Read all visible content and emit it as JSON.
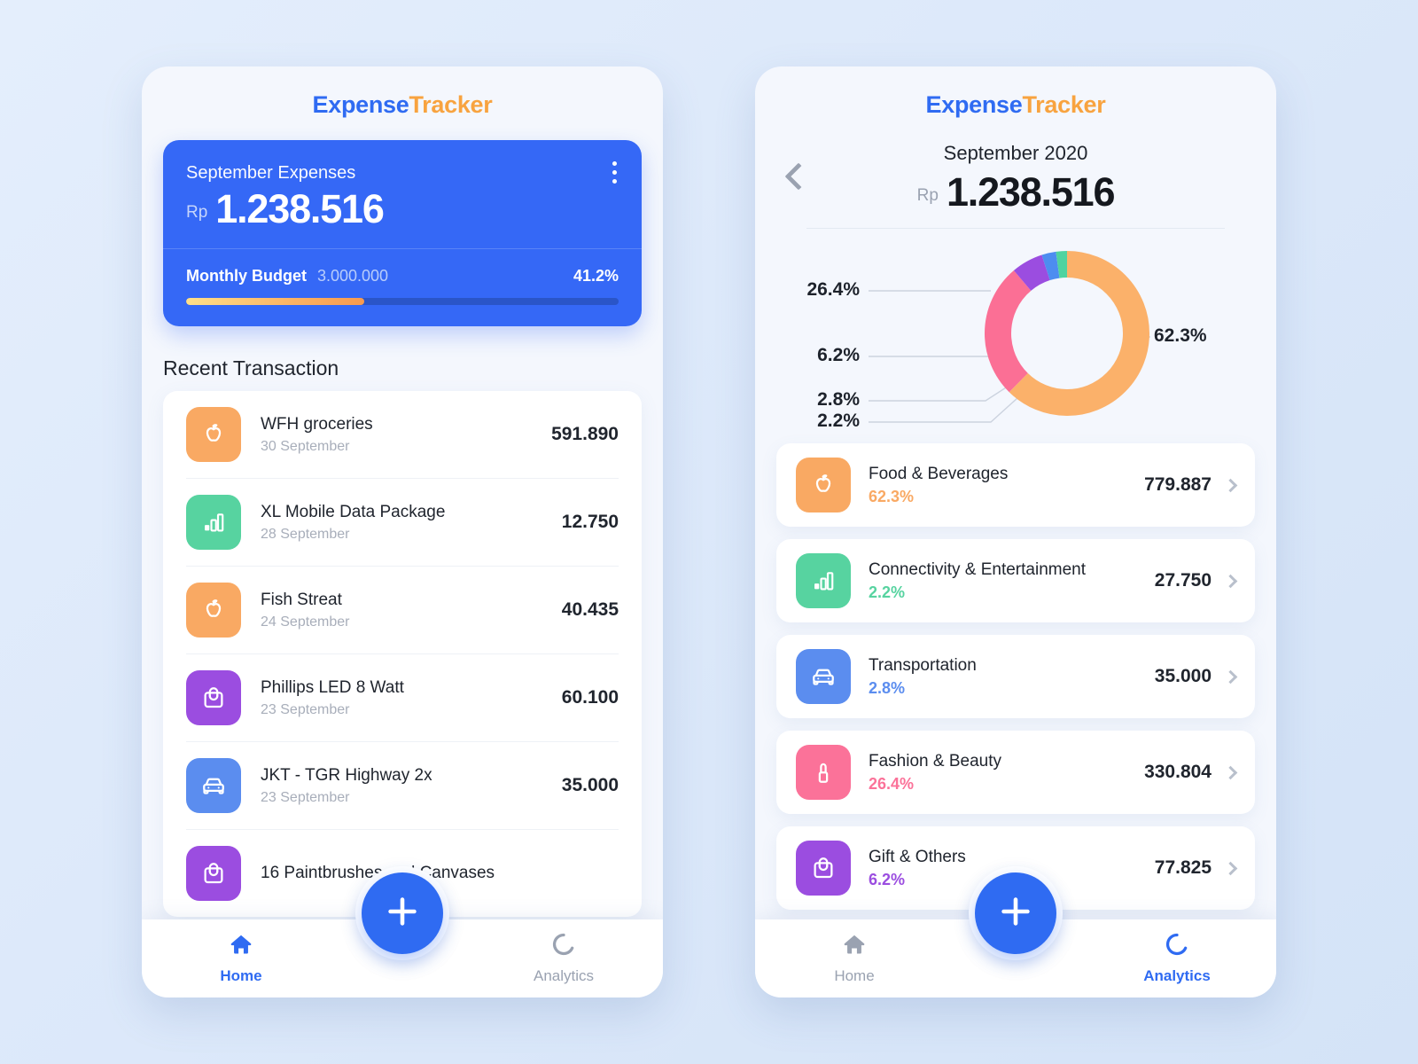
{
  "brand": {
    "part1": "Expense",
    "part2": "Tracker",
    "color1": "#2f6bf2",
    "color2": "#f8a33f"
  },
  "home": {
    "hero": {
      "title": "September Expenses",
      "currency": "Rp",
      "amount": "1.238.516",
      "menu_icon": "kebab-menu-icon",
      "budget_label": "Monthly Budget",
      "budget_amount": "3.000.000",
      "budget_percent": "41.2%",
      "progress_value": 41.2,
      "card_color": "#3568f6"
    },
    "section_title": "Recent Transaction",
    "transactions": [
      {
        "name": "WFH groceries",
        "date": "30 September",
        "amount": "591.890",
        "icon": "apple-icon",
        "color": "#f9a963"
      },
      {
        "name": "XL Mobile Data Package",
        "date": "28 September",
        "amount": "12.750",
        "icon": "signal-bars-icon",
        "color": "#57d3a0"
      },
      {
        "name": "Fish Streat",
        "date": "24 September",
        "amount": "40.435",
        "icon": "apple-icon",
        "color": "#f9a963"
      },
      {
        "name": "Phillips LED 8 Watt",
        "date": "23 September",
        "amount": "60.100",
        "icon": "shopping-bag-icon",
        "color": "#9b4de0"
      },
      {
        "name": "JKT - TGR Highway 2x",
        "date": "23 September",
        "amount": "35.000",
        "icon": "car-icon",
        "color": "#5b8def"
      },
      {
        "name": "16 Paintbrushes and Canvases",
        "date": "",
        "amount": "",
        "icon": "shopping-bag-icon",
        "color": "#9b4de0"
      }
    ]
  },
  "analytics": {
    "back_icon": "chevron-left-icon",
    "month": "September 2020",
    "currency": "Rp",
    "amount": "1.238.516",
    "categories": [
      {
        "name": "Food & Beverages",
        "percent": "62.3%",
        "amount": "779.887",
        "icon": "apple-icon",
        "color": "#f9a963"
      },
      {
        "name": "Connectivity & Entertainment",
        "percent": "2.2%",
        "amount": "27.750",
        "icon": "signal-bars-icon",
        "color": "#57d3a0"
      },
      {
        "name": "Transportation",
        "percent": "2.8%",
        "amount": "35.000",
        "icon": "car-icon",
        "color": "#5b8def"
      },
      {
        "name": "Fashion & Beauty",
        "percent": "26.4%",
        "amount": "330.804",
        "icon": "lipstick-icon",
        "color": "#fb7299"
      },
      {
        "name": "Gift & Others",
        "percent": "6.2%",
        "amount": "77.825",
        "icon": "shopping-bag-icon",
        "color": "#9b4de0"
      }
    ]
  },
  "chart_data": {
    "type": "pie",
    "title": "",
    "legend_position": "list-below",
    "labels": [
      "Food & Beverages",
      "Fashion & Beauty",
      "Gift & Others",
      "Transportation",
      "Connectivity & Entertainment"
    ],
    "values": [
      62.3,
      26.4,
      6.2,
      2.8,
      2.2
    ],
    "value_labels": [
      "62.3%",
      "26.4%",
      "6.2%",
      "2.8%",
      "2.2%"
    ],
    "amounts": [
      "779.887",
      "330.804",
      "77.825",
      "35.000",
      "27.750"
    ],
    "colors": [
      "#fbb16a",
      "#fb6f95",
      "#9b4de0",
      "#4d8df0",
      "#4fd3a0"
    ],
    "total_label": "1.238.516",
    "donut": true
  },
  "nav": {
    "home_label": "Home",
    "analytics_label": "Analytics",
    "home_icon": "home-icon",
    "analytics_icon": "donut-chart-icon",
    "fab_icon": "plus-icon",
    "active_color": "#2f6bf2",
    "idle_color": "#9aa2b1"
  }
}
